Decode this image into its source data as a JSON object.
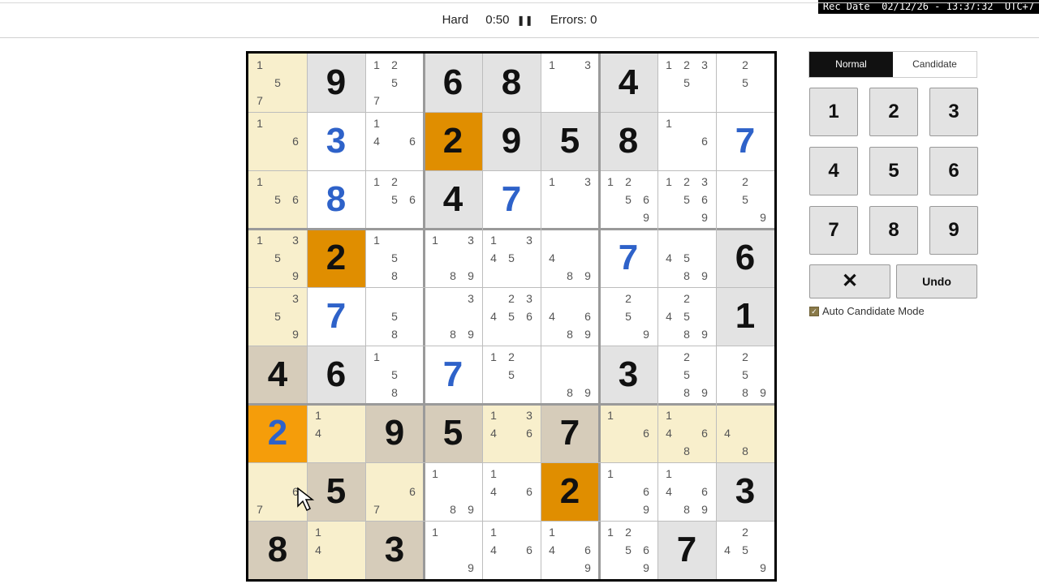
{
  "recording": {
    "label": "Rec Date  02/12/26 - 13:37:32  UTC+7"
  },
  "header": {
    "difficulty": "Hard",
    "timer": "0:50",
    "pause_icon": "pause-icon",
    "errors": "Errors: 0"
  },
  "colors": {
    "given": "#111111",
    "user": "#2e62c9",
    "highlight_orange": "#e08e00",
    "bright_orange": "#f59d0a",
    "tan": "#d6ccba",
    "cream": "#f8efcc",
    "grey": "#e3e3e3",
    "white": "#ffffff"
  },
  "board": {
    "cells": [
      [
        {
          "v": "",
          "c": [
            "1",
            "",
            "",
            "",
            "5",
            "",
            "7",
            "",
            ""
          ],
          "bg": "cream"
        },
        {
          "v": "9",
          "t": "given",
          "bg": "grey"
        },
        {
          "v": "",
          "c": [
            "1",
            "2",
            "",
            "",
            "5",
            "",
            "7",
            "",
            ""
          ],
          "bg": "white"
        },
        {
          "v": "6",
          "t": "given",
          "bg": "grey"
        },
        {
          "v": "8",
          "t": "given",
          "bg": "grey"
        },
        {
          "v": "",
          "c": [
            "1",
            "",
            "3",
            "",
            "",
            "",
            "",
            "",
            ""
          ],
          "bg": "white"
        },
        {
          "v": "4",
          "t": "given",
          "bg": "grey"
        },
        {
          "v": "",
          "c": [
            "1",
            "2",
            "3",
            "",
            "5",
            "",
            "",
            "",
            ""
          ],
          "bg": "white"
        },
        {
          "v": "",
          "c": [
            "",
            "2",
            "",
            "",
            "5",
            "",
            "",
            "",
            ""
          ],
          "bg": "white"
        }
      ],
      [
        {
          "v": "",
          "c": [
            "1",
            "",
            "",
            "",
            "",
            "6",
            "",
            "",
            ""
          ],
          "bg": "cream"
        },
        {
          "v": "3",
          "t": "user",
          "bg": "white"
        },
        {
          "v": "",
          "c": [
            "1",
            "",
            "",
            "4",
            "",
            "6",
            "",
            "",
            ""
          ],
          "bg": "white"
        },
        {
          "v": "2",
          "t": "given",
          "bg": "orange"
        },
        {
          "v": "9",
          "t": "given",
          "bg": "grey"
        },
        {
          "v": "5",
          "t": "given",
          "bg": "grey"
        },
        {
          "v": "8",
          "t": "given",
          "bg": "grey"
        },
        {
          "v": "",
          "c": [
            "1",
            "",
            "",
            "",
            "",
            "6",
            "",
            "",
            ""
          ],
          "bg": "white"
        },
        {
          "v": "7",
          "t": "user",
          "bg": "white"
        }
      ],
      [
        {
          "v": "",
          "c": [
            "1",
            "",
            "",
            "",
            "5",
            "6",
            "",
            "",
            ""
          ],
          "bg": "cream"
        },
        {
          "v": "8",
          "t": "user",
          "bg": "white"
        },
        {
          "v": "",
          "c": [
            "1",
            "2",
            "",
            "",
            "5",
            "6",
            "",
            "",
            ""
          ],
          "bg": "white"
        },
        {
          "v": "4",
          "t": "given",
          "bg": "grey"
        },
        {
          "v": "7",
          "t": "user",
          "bg": "white"
        },
        {
          "v": "",
          "c": [
            "1",
            "",
            "3",
            "",
            "",
            "",
            "",
            "",
            ""
          ],
          "bg": "white"
        },
        {
          "v": "",
          "c": [
            "1",
            "2",
            "",
            "",
            "5",
            "6",
            "",
            "",
            "9"
          ],
          "bg": "white"
        },
        {
          "v": "",
          "c": [
            "1",
            "2",
            "3",
            "",
            "5",
            "6",
            "",
            "",
            "9"
          ],
          "bg": "white"
        },
        {
          "v": "",
          "c": [
            "",
            "2",
            "",
            "",
            "5",
            "",
            "",
            "",
            "9"
          ],
          "bg": "white"
        }
      ],
      [
        {
          "v": "",
          "c": [
            "1",
            "",
            "3",
            "",
            "5",
            "",
            "",
            "",
            "9"
          ],
          "bg": "cream"
        },
        {
          "v": "2",
          "t": "given",
          "bg": "orange"
        },
        {
          "v": "",
          "c": [
            "1",
            "",
            "",
            "",
            "5",
            "",
            "",
            "8",
            ""
          ],
          "bg": "white"
        },
        {
          "v": "",
          "c": [
            "1",
            "",
            "3",
            "",
            "",
            "",
            "",
            "8",
            "9"
          ],
          "bg": "white"
        },
        {
          "v": "",
          "c": [
            "1",
            "",
            "3",
            "4",
            "5",
            "",
            "",
            "",
            ""
          ],
          "bg": "white"
        },
        {
          "v": "",
          "c": [
            "",
            "",
            "",
            "4",
            "",
            "",
            "",
            "8",
            "9"
          ],
          "bg": "white"
        },
        {
          "v": "7",
          "t": "user",
          "bg": "white"
        },
        {
          "v": "",
          "c": [
            "",
            "",
            "",
            "4",
            "5",
            "",
            "",
            "8",
            "9"
          ],
          "bg": "white"
        },
        {
          "v": "6",
          "t": "given",
          "bg": "grey"
        }
      ],
      [
        {
          "v": "",
          "c": [
            "",
            "",
            "3",
            "",
            "5",
            "",
            "",
            "",
            "9"
          ],
          "bg": "cream"
        },
        {
          "v": "7",
          "t": "user",
          "bg": "white"
        },
        {
          "v": "",
          "c": [
            "",
            "",
            "",
            "",
            "5",
            "",
            "",
            "8",
            ""
          ],
          "bg": "white"
        },
        {
          "v": "",
          "c": [
            "",
            "",
            "3",
            "",
            "",
            "",
            "",
            "8",
            "9"
          ],
          "bg": "white"
        },
        {
          "v": "",
          "c": [
            "",
            "2",
            "3",
            "4",
            "5",
            "6",
            "",
            "",
            ""
          ],
          "bg": "white"
        },
        {
          "v": "",
          "c": [
            "",
            "",
            "",
            "4",
            "",
            "6",
            "",
            "8",
            "9"
          ],
          "bg": "white"
        },
        {
          "v": "",
          "c": [
            "",
            "2",
            "",
            "",
            "5",
            "",
            "",
            "",
            "9"
          ],
          "bg": "white"
        },
        {
          "v": "",
          "c": [
            "",
            "2",
            "",
            "4",
            "5",
            "",
            "",
            "8",
            "9"
          ],
          "bg": "white"
        },
        {
          "v": "1",
          "t": "given",
          "bg": "grey"
        }
      ],
      [
        {
          "v": "4",
          "t": "given",
          "bg": "tan"
        },
        {
          "v": "6",
          "t": "given",
          "bg": "grey"
        },
        {
          "v": "",
          "c": [
            "1",
            "",
            "",
            "",
            "5",
            "",
            "",
            "8",
            ""
          ],
          "bg": "white"
        },
        {
          "v": "7",
          "t": "user",
          "bg": "white"
        },
        {
          "v": "",
          "c": [
            "1",
            "2",
            "",
            "",
            "5",
            "",
            "",
            "",
            ""
          ],
          "bg": "white"
        },
        {
          "v": "",
          "c": [
            "",
            "",
            "",
            "",
            "",
            "",
            "",
            "8",
            "9"
          ],
          "bg": "white"
        },
        {
          "v": "3",
          "t": "given",
          "bg": "grey"
        },
        {
          "v": "",
          "c": [
            "",
            "2",
            "",
            "",
            "5",
            "",
            "",
            "8",
            "9"
          ],
          "bg": "white"
        },
        {
          "v": "",
          "c": [
            "",
            "2",
            "",
            "",
            "5",
            "",
            "",
            "8",
            "9"
          ],
          "bg": "white"
        }
      ],
      [
        {
          "v": "2",
          "t": "user",
          "bg": "bright"
        },
        {
          "v": "",
          "c": [
            "1",
            "",
            "",
            "4",
            "",
            "",
            "",
            "",
            ""
          ],
          "bg": "cream"
        },
        {
          "v": "9",
          "t": "given",
          "bg": "tan"
        },
        {
          "v": "5",
          "t": "given",
          "bg": "tan"
        },
        {
          "v": "",
          "c": [
            "1",
            "",
            "3",
            "4",
            "",
            "6",
            "",
            "",
            ""
          ],
          "bg": "cream"
        },
        {
          "v": "7",
          "t": "given",
          "bg": "tan"
        },
        {
          "v": "",
          "c": [
            "1",
            "",
            "",
            "",
            "",
            "6",
            "",
            "",
            ""
          ],
          "bg": "cream"
        },
        {
          "v": "",
          "c": [
            "1",
            "",
            "",
            "4",
            "",
            "6",
            "",
            "8",
            ""
          ],
          "bg": "cream"
        },
        {
          "v": "",
          "c": [
            "",
            "",
            "",
            "4",
            "",
            "",
            "",
            "8",
            ""
          ],
          "bg": "cream"
        }
      ],
      [
        {
          "v": "",
          "c": [
            "",
            "",
            "",
            "",
            "",
            "6",
            "7",
            "",
            ""
          ],
          "bg": "cream"
        },
        {
          "v": "5",
          "t": "given",
          "bg": "tan"
        },
        {
          "v": "",
          "c": [
            "",
            "",
            "",
            "",
            "",
            "6",
            "7",
            "",
            ""
          ],
          "bg": "cream"
        },
        {
          "v": "",
          "c": [
            "1",
            "",
            "",
            "",
            "",
            "",
            "",
            "8",
            "9"
          ],
          "bg": "white"
        },
        {
          "v": "",
          "c": [
            "1",
            "",
            "",
            "4",
            "",
            "6",
            "",
            "",
            ""
          ],
          "bg": "white"
        },
        {
          "v": "2",
          "t": "given",
          "bg": "orange"
        },
        {
          "v": "",
          "c": [
            "1",
            "",
            "",
            "",
            "",
            "6",
            "",
            "",
            "9"
          ],
          "bg": "white"
        },
        {
          "v": "",
          "c": [
            "1",
            "",
            "",
            "4",
            "",
            "6",
            "",
            "8",
            "9"
          ],
          "bg": "white"
        },
        {
          "v": "3",
          "t": "given",
          "bg": "grey"
        }
      ],
      [
        {
          "v": "8",
          "t": "given",
          "bg": "tan"
        },
        {
          "v": "",
          "c": [
            "1",
            "",
            "",
            "4",
            "",
            "",
            "",
            "",
            ""
          ],
          "bg": "cream"
        },
        {
          "v": "3",
          "t": "given",
          "bg": "tan"
        },
        {
          "v": "",
          "c": [
            "1",
            "",
            "",
            "",
            "",
            "",
            "",
            "",
            "9"
          ],
          "bg": "white"
        },
        {
          "v": "",
          "c": [
            "1",
            "",
            "",
            "4",
            "",
            "6",
            "",
            "",
            ""
          ],
          "bg": "white"
        },
        {
          "v": "",
          "c": [
            "1",
            "",
            "",
            "4",
            "",
            "6",
            "",
            "",
            "9"
          ],
          "bg": "white"
        },
        {
          "v": "",
          "c": [
            "1",
            "2",
            "",
            "",
            "5",
            "6",
            "",
            "",
            "9"
          ],
          "bg": "white"
        },
        {
          "v": "7",
          "t": "given",
          "bg": "grey"
        },
        {
          "v": "",
          "c": [
            "",
            "2",
            "",
            "4",
            "5",
            "",
            "",
            "",
            "9"
          ],
          "bg": "white"
        }
      ]
    ]
  },
  "controls": {
    "mode_tabs": [
      {
        "label": "Normal",
        "active": true
      },
      {
        "label": "Candidate",
        "active": false
      }
    ],
    "numbers": [
      "1",
      "2",
      "3",
      "4",
      "5",
      "6",
      "7",
      "8",
      "9"
    ],
    "erase_label": "✕",
    "undo_label": "Undo",
    "auto_candidate_label": "Auto Candidate Mode",
    "auto_candidate_checked": true
  }
}
